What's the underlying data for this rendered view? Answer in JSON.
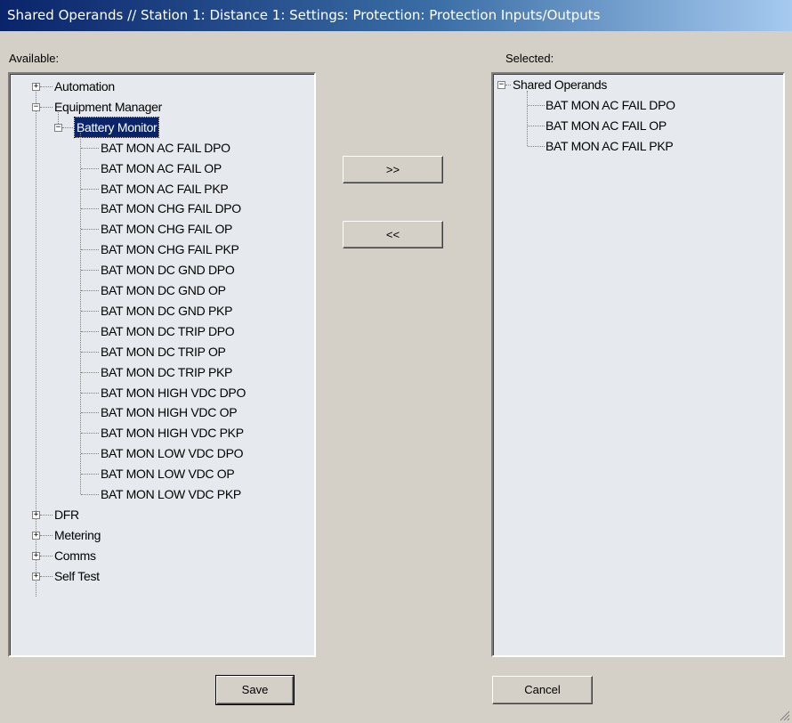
{
  "window": {
    "title": "Shared Operands // Station 1: Distance 1: Settings: Protection: Protection Inputs/Outputs"
  },
  "available": {
    "label": "Available:",
    "tree": {
      "automation": "Automation",
      "equipment_manager": "Equipment Manager",
      "battery_monitor": "Battery Monitor",
      "operands": [
        "BAT MON AC FAIL DPO",
        "BAT MON AC FAIL OP",
        "BAT MON AC FAIL PKP",
        "BAT MON CHG FAIL DPO",
        "BAT MON CHG FAIL OP",
        "BAT MON CHG FAIL PKP",
        "BAT MON DC GND DPO",
        "BAT MON DC GND OP",
        "BAT MON DC GND PKP",
        "BAT MON DC TRIP DPO",
        "BAT MON DC TRIP OP",
        "BAT MON DC TRIP PKP",
        "BAT MON HIGH VDC DPO",
        "BAT MON HIGH VDC OP",
        "BAT MON HIGH VDC PKP",
        "BAT MON LOW VDC DPO",
        "BAT MON LOW VDC OP",
        "BAT MON LOW VDC PKP"
      ],
      "dfr": "DFR",
      "metering": "Metering",
      "comms": "Comms",
      "self_test": "Self Test"
    }
  },
  "selected": {
    "label": "Selected:",
    "root": "Shared Operands",
    "items": [
      "BAT MON AC FAIL DPO",
      "BAT MON AC FAIL OP",
      "BAT MON AC FAIL PKP"
    ]
  },
  "buttons": {
    "add": ">>",
    "remove": "<<",
    "save": "Save",
    "cancel": "Cancel"
  },
  "icons": {
    "expand": "+",
    "collapse": "−"
  }
}
